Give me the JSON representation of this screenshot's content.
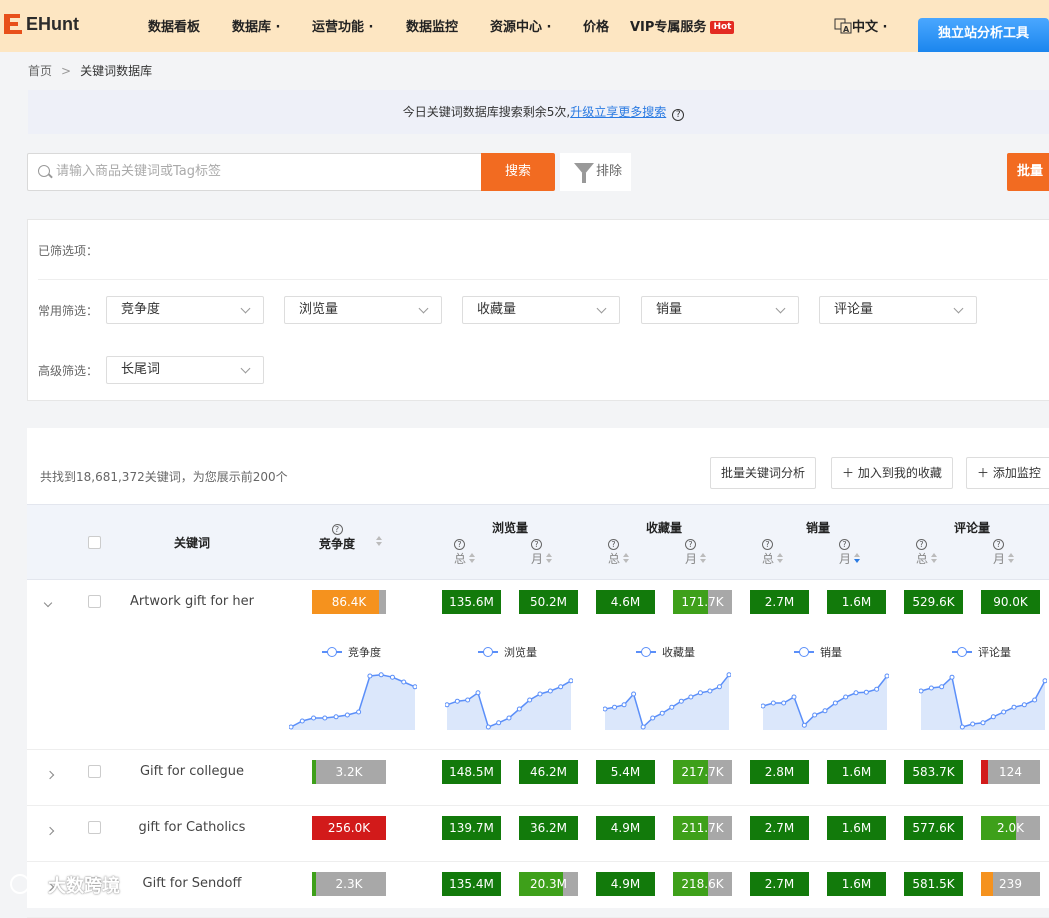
{
  "nav": {
    "logo": "EHunt",
    "items": [
      "数据看板",
      "数据库 ·",
      "运营功能 ·",
      "数据监控",
      "资源中心 ·",
      "价格",
      "VIP专属服务"
    ],
    "hot": "Hot",
    "lang": "中文 ·",
    "tool_button": "独立站分析工具"
  },
  "breadcrumb": {
    "home": "首页",
    "sep": ">",
    "current": "关键词数据库"
  },
  "notice": {
    "text": "今日关键词数据库搜索剩余5次,",
    "link": "升级立享更多搜索",
    "help": "?"
  },
  "search": {
    "placeholder": "请输入商品关键词或Tag标签",
    "button": "搜索",
    "filter": "排除",
    "batch": "批量"
  },
  "filters": {
    "selected_label": "已筛选项：",
    "common_label": "常用筛选：",
    "advanced_label": "高级筛选：",
    "common": [
      "竞争度",
      "浏览量",
      "收藏量",
      "销量",
      "评论量"
    ],
    "advanced": [
      "长尾词"
    ]
  },
  "result": {
    "count_text": "共找到18,681,372关键词，为您展示前200个",
    "actions": [
      "批量关键词分析",
      "＋ 加入到我的收藏",
      "＋ 添加监控"
    ]
  },
  "table": {
    "headers": {
      "keyword": "关键词",
      "competition": "竞争度",
      "views": "浏览量",
      "favorites": "收藏量",
      "sales": "销量",
      "reviews": "评论量",
      "total": "总",
      "month": "月",
      "help": "?"
    },
    "rows": [
      {
        "keyword": "Artwork gift for her",
        "expanded": true,
        "competition": "86.4K",
        "comp_fill": 0.9,
        "comp_color": "#f5921e",
        "values": [
          "135.6M",
          "50.2M",
          "4.6M",
          "171.7K",
          "2.7M",
          "1.6M",
          "529.6K",
          "90.0K"
        ],
        "fills": [
          1,
          1,
          1,
          0.6,
          1,
          1,
          1,
          1
        ],
        "colors": [
          "#127a0b",
          "#127a0b",
          "#127a0b",
          "#3ea01a",
          "#127a0b",
          "#127a0b",
          "#127a0b",
          "#127a0b"
        ]
      },
      {
        "keyword": "Gift for collegue",
        "expanded": false,
        "competition": "3.2K",
        "comp_fill": 0.05,
        "comp_color": "#3ea01a",
        "values": [
          "148.5M",
          "46.2M",
          "5.4M",
          "217.7K",
          "2.8M",
          "1.6M",
          "583.7K",
          "124"
        ],
        "fills": [
          1,
          1,
          1,
          0.6,
          1,
          1,
          1,
          0.12
        ],
        "colors": [
          "#127a0b",
          "#127a0b",
          "#127a0b",
          "#3ea01a",
          "#127a0b",
          "#127a0b",
          "#127a0b",
          "#d21a1a"
        ]
      },
      {
        "keyword": "gift for Catholics",
        "expanded": false,
        "competition": "256.0K",
        "comp_fill": 1,
        "comp_color": "#d21a1a",
        "values": [
          "139.7M",
          "36.2M",
          "4.9M",
          "211.7K",
          "2.7M",
          "1.6M",
          "577.6K",
          "2.0K"
        ],
        "fills": [
          1,
          1,
          1,
          0.6,
          1,
          1,
          1,
          0.6
        ],
        "colors": [
          "#127a0b",
          "#127a0b",
          "#127a0b",
          "#3ea01a",
          "#127a0b",
          "#127a0b",
          "#127a0b",
          "#3ea01a"
        ]
      },
      {
        "keyword": "Gift for Sendoff",
        "expanded": false,
        "competition": "2.3K",
        "comp_fill": 0.05,
        "comp_color": "#3ea01a",
        "values": [
          "135.4M",
          "20.3M",
          "4.9M",
          "218.6K",
          "2.7M",
          "1.6M",
          "581.5K",
          "239"
        ],
        "fills": [
          1,
          0.75,
          1,
          0.6,
          1,
          1,
          1,
          0.2
        ],
        "colors": [
          "#127a0b",
          "#3ea01a",
          "#127a0b",
          "#3ea01a",
          "#127a0b",
          "#127a0b",
          "#127a0b",
          "#f5921e"
        ]
      }
    ]
  },
  "trends": {
    "legends": [
      "竞争度",
      "浏览量",
      "收藏量",
      "销量",
      "评论量"
    ]
  },
  "watermark": "大数跨境"
}
